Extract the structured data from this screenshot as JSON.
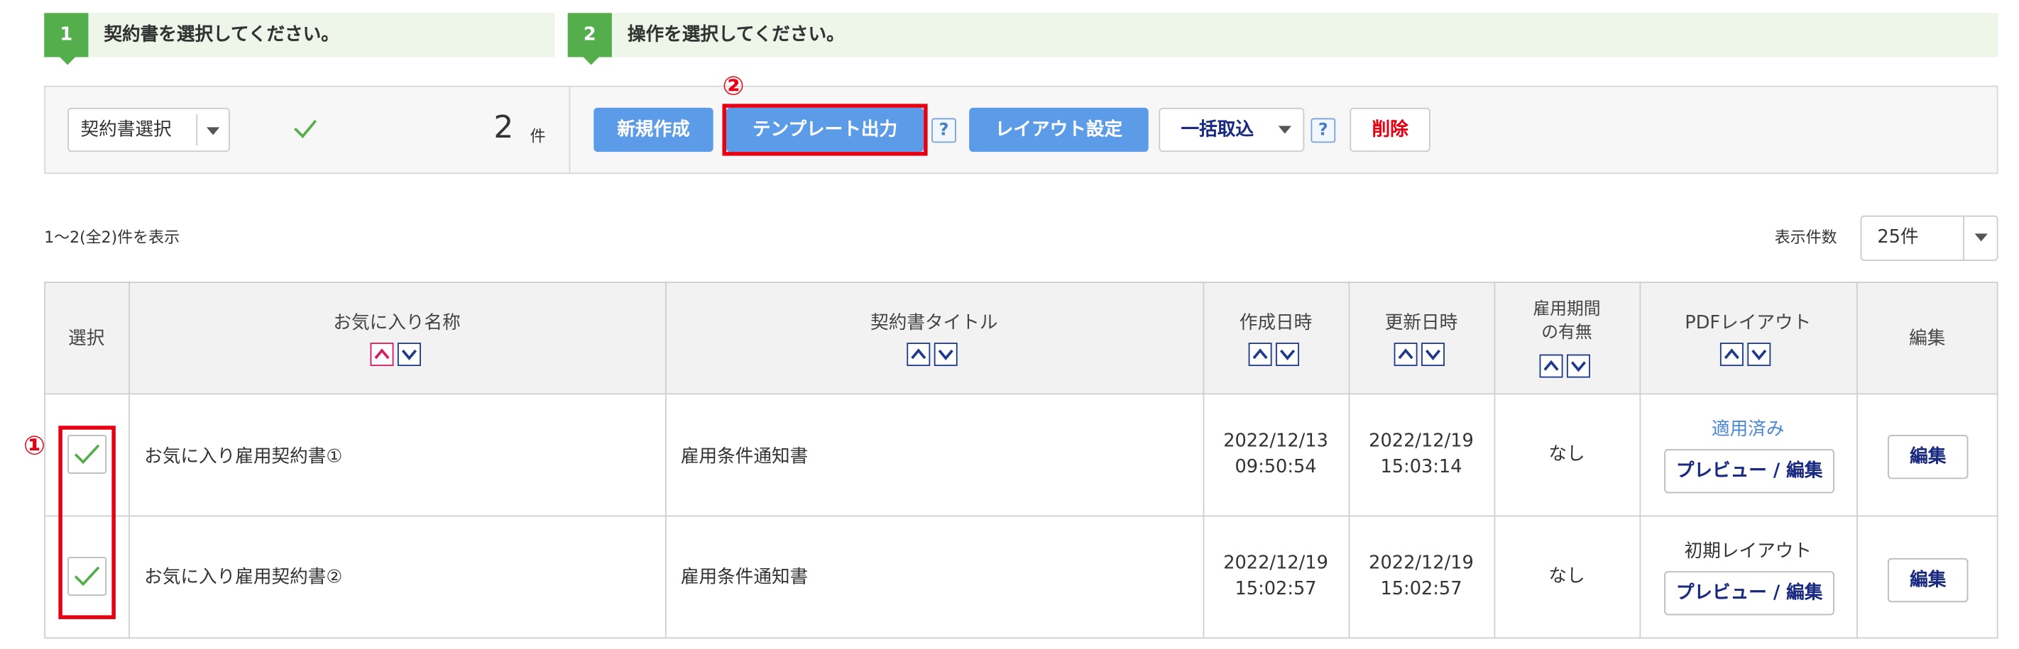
{
  "steps": [
    {
      "number": "1",
      "label": "契約書を選択してください。"
    },
    {
      "number": "2",
      "label": "操作を選択してください。"
    }
  ],
  "selector": {
    "label": "契約書選択",
    "count": "2",
    "count_unit": "件"
  },
  "toolbar": {
    "new_label": "新規作成",
    "template_label": "テンプレート出力",
    "layout_label": "レイアウト設定",
    "bulk_label": "一括取込",
    "delete_label": "削除",
    "help_mark": "?"
  },
  "annotations": {
    "template": "②",
    "checkbox": "①"
  },
  "list_info": {
    "range": "1～2(全2)件を表示",
    "per_page_label": "表示件数",
    "per_page_value": "25件"
  },
  "table": {
    "headers": {
      "select": "選択",
      "favorite_name": "お気に入り名称",
      "contract_title": "契約書タイトル",
      "created": "作成日時",
      "updated": "更新日時",
      "period_line1": "雇用期間",
      "period_line2": "の有無",
      "pdf_layout": "PDFレイアウト",
      "edit": "編集"
    },
    "rows": [
      {
        "name": "お気に入り雇用契約書①",
        "title": "雇用条件通知書",
        "created_date": "2022/12/13",
        "created_time": "09:50:54",
        "updated_date": "2022/12/19",
        "updated_time": "15:03:14",
        "period": "なし",
        "layout_status": "適用済み",
        "preview_label": "プレビュー / 編集",
        "edit_label": "編集"
      },
      {
        "name": "お気に入り雇用契約書②",
        "title": "雇用条件通知書",
        "created_date": "2022/12/19",
        "created_time": "15:02:57",
        "updated_date": "2022/12/19",
        "updated_time": "15:02:57",
        "period": "なし",
        "layout_status": "初期レイアウト",
        "preview_label": "プレビュー / 編集",
        "edit_label": "編集"
      }
    ]
  },
  "colors": {
    "step_green": "#55ae4c",
    "step_bg": "#eef6ea",
    "button_blue": "#5b9be8",
    "highlight_red": "#e60012",
    "applied_blue": "#4a86d4",
    "delete_red": "#e60012",
    "check_green": "#55ae4c"
  },
  "icons": [
    "check-icon",
    "chevron-down-icon",
    "sort-asc-icon",
    "sort-desc-icon",
    "help-icon"
  ]
}
